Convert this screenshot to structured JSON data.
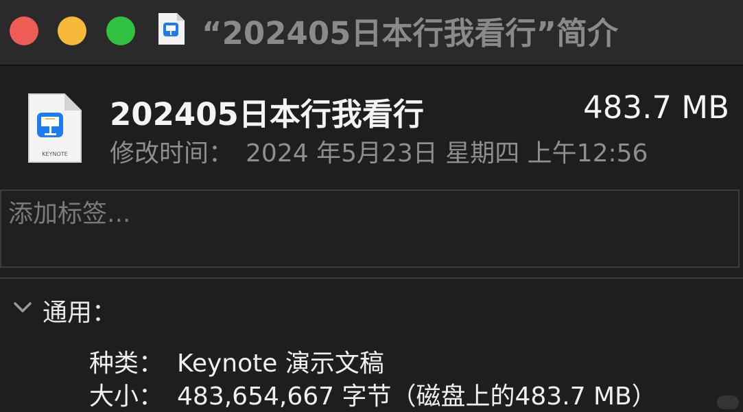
{
  "window": {
    "title": "“202405日本行我看行”简介",
    "controls": {
      "close_color": "#ee5e57",
      "minimize_color": "#f6b93b",
      "maximize_color": "#30c140"
    }
  },
  "file": {
    "name": "202405日本行我看行",
    "size": "483.7 MB",
    "modified_label": "修改时间：",
    "modified_value": "2024 年5月23日 星期四 上午12:56",
    "icon": "keynote-document-icon",
    "icon_caption": "KEYNOTE"
  },
  "tags": {
    "placeholder": "添加标签..."
  },
  "general": {
    "title": "通用：",
    "expanded": true,
    "kind_label": "种类：",
    "kind_value": "Keynote 演示文稿",
    "size_label": "大小：",
    "size_value": "483,654,667 字节（磁盘上的483.7 MB）"
  },
  "colors": {
    "background": "#1e1e1e",
    "titlebar": "#2a2a2a",
    "keynote_blue": "#1f7bf2"
  }
}
